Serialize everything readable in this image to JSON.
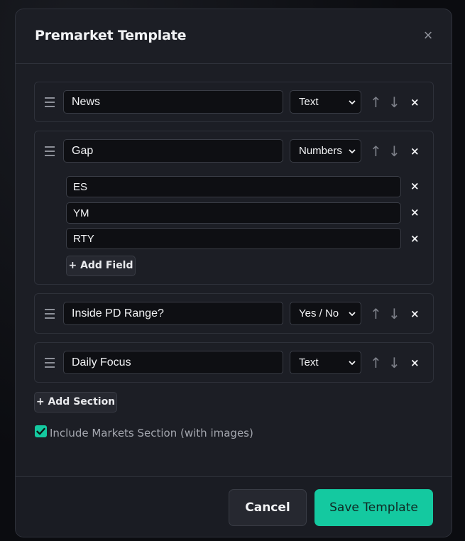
{
  "modal": {
    "title": "Premarket Template",
    "close_symbol": "×"
  },
  "sections": [
    {
      "name": "News",
      "type": "Text"
    },
    {
      "name": "Gap",
      "type": "Numbers",
      "fields": [
        "ES",
        "YM",
        "RTY"
      ],
      "add_field_label": "+ Add Field"
    },
    {
      "name": "Inside PD Range?",
      "type": "Yes / No"
    },
    {
      "name": "Daily Focus",
      "type": "Text"
    }
  ],
  "symbols": {
    "up": "↑",
    "down": "↓",
    "delete": "×"
  },
  "add_section_label": "+ Add Section",
  "include_markets": {
    "checked": true,
    "label": "Include Markets Section (with images)"
  },
  "footer": {
    "cancel_label": "Cancel",
    "save_label": "Save Template"
  },
  "colors": {
    "accent": "#14c9a0",
    "background": "#1c1e25",
    "input_bg": "#0e0f13"
  }
}
